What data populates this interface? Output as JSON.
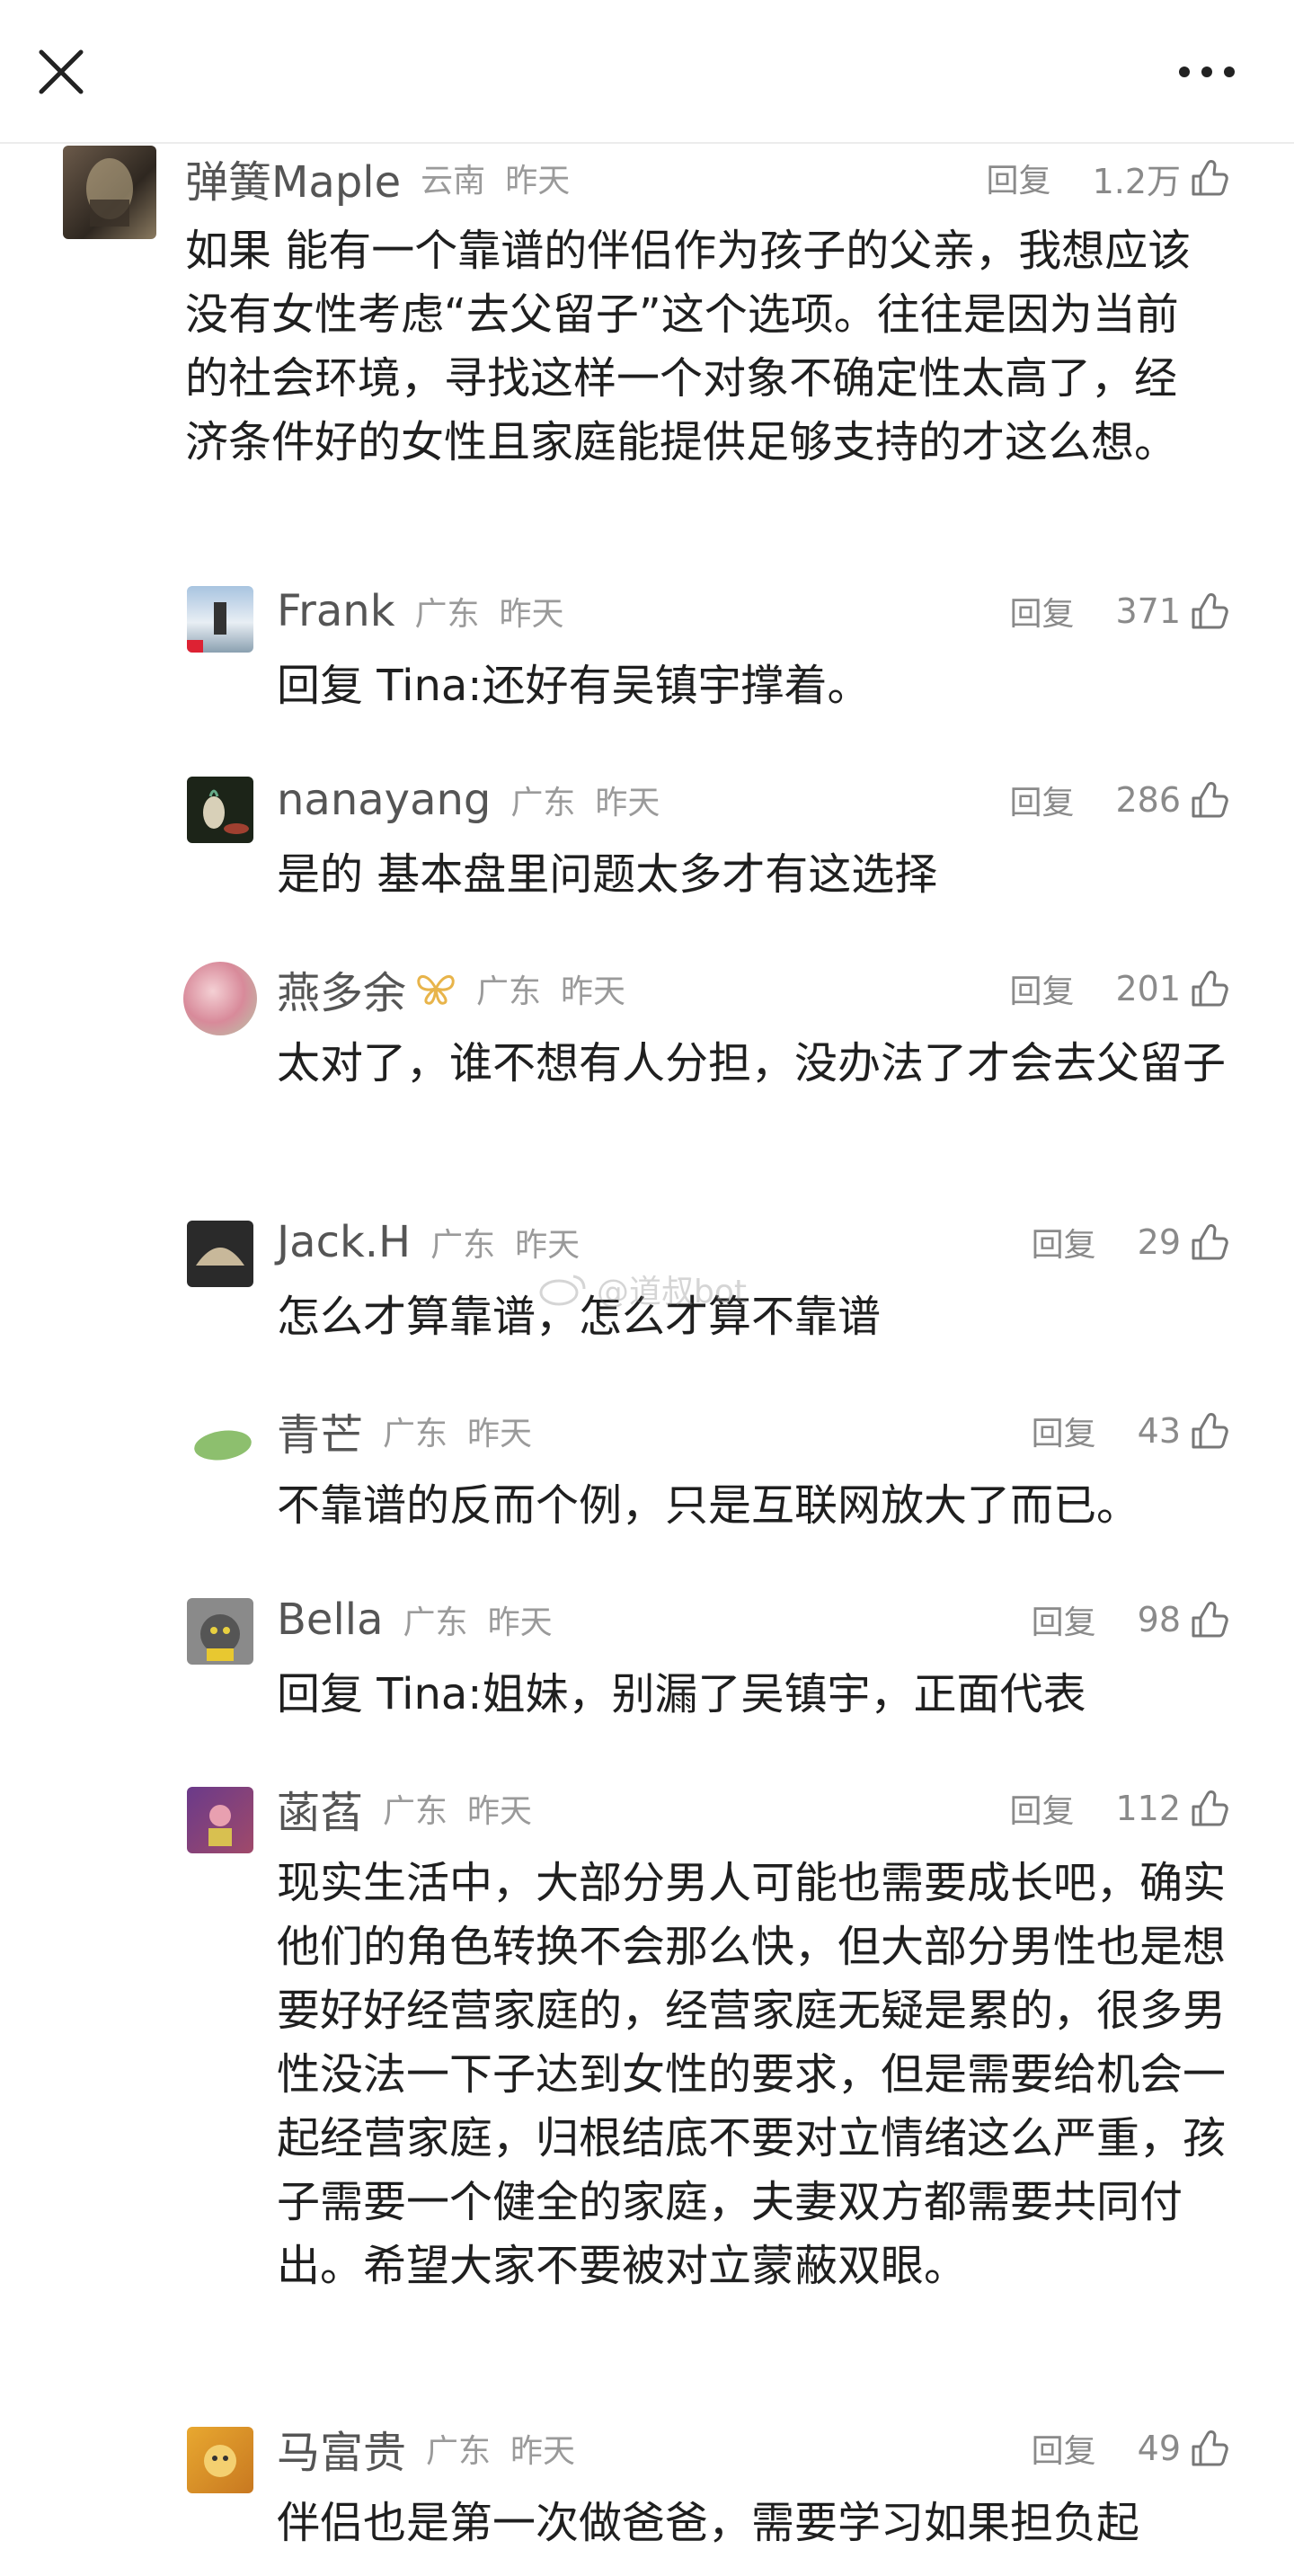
{
  "header": {
    "close_icon": "close-icon",
    "more_icon": "more-horizontal-icon"
  },
  "watermark": "@道叔bot",
  "reply_label": "回复",
  "comments": [
    {
      "user": "弹簧Maple",
      "location": "云南",
      "time": "昨天",
      "likes": "1.2万",
      "text": "如果 能有一个靠谱的伴侣作为孩子的父亲，我想应该没有女性考虑“去父留子”这个选项。往往是因为当前的社会环境，寻找这样一个对象不确定性太高了，经济条件好的女性且家庭能提供足够支持的才这么想。"
    },
    {
      "user": "Frank",
      "location": "广东",
      "time": "昨天",
      "likes": "371",
      "reply_to": "回复 Tina:",
      "text": "还好有吴镇宇撑着。"
    },
    {
      "user": "nanayang",
      "location": "广东",
      "time": "昨天",
      "likes": "286",
      "text": "是的 基本盘里问题太多才有这选择"
    },
    {
      "user": "燕多余",
      "location": "广东",
      "time": "昨天",
      "likes": "201",
      "text": "太对了，谁不想有人分担，没办法了才会去父留子"
    },
    {
      "user": "Jack.H",
      "location": "广东",
      "time": "昨天",
      "likes": "29",
      "text": "怎么才算靠谱，怎么才算不靠谱"
    },
    {
      "user": "青芒",
      "location": "广东",
      "time": "昨天",
      "likes": "43",
      "text": "不靠谱的反而个例，只是互联网放大了而已。"
    },
    {
      "user": "Bella",
      "location": "广东",
      "time": "昨天",
      "likes": "98",
      "reply_to": "回复 Tina:",
      "text": "姐妹，别漏了吴镇宇，正面代表"
    },
    {
      "user": "菡萏",
      "location": "广东",
      "time": "昨天",
      "likes": "112",
      "text": "现实生活中，大部分男人可能也需要成长吧，确实他们的角色转换不会那么快，但大部分男性也是想要好好经营家庭的，经营家庭无疑是累的，很多男性没法一下子达到女性的要求，但是需要给机会一起经营家庭，归根结底不要对立情绪这么严重，孩子需要一个健全的家庭，夫妻双方都需要共同付出。希望大家不要被对立蒙蔽双眼。"
    },
    {
      "user": "马富贵",
      "location": "广东",
      "time": "昨天",
      "likes": "49",
      "text": "伴侣也是第一次做爸爸，需要学习如果担负起"
    }
  ]
}
